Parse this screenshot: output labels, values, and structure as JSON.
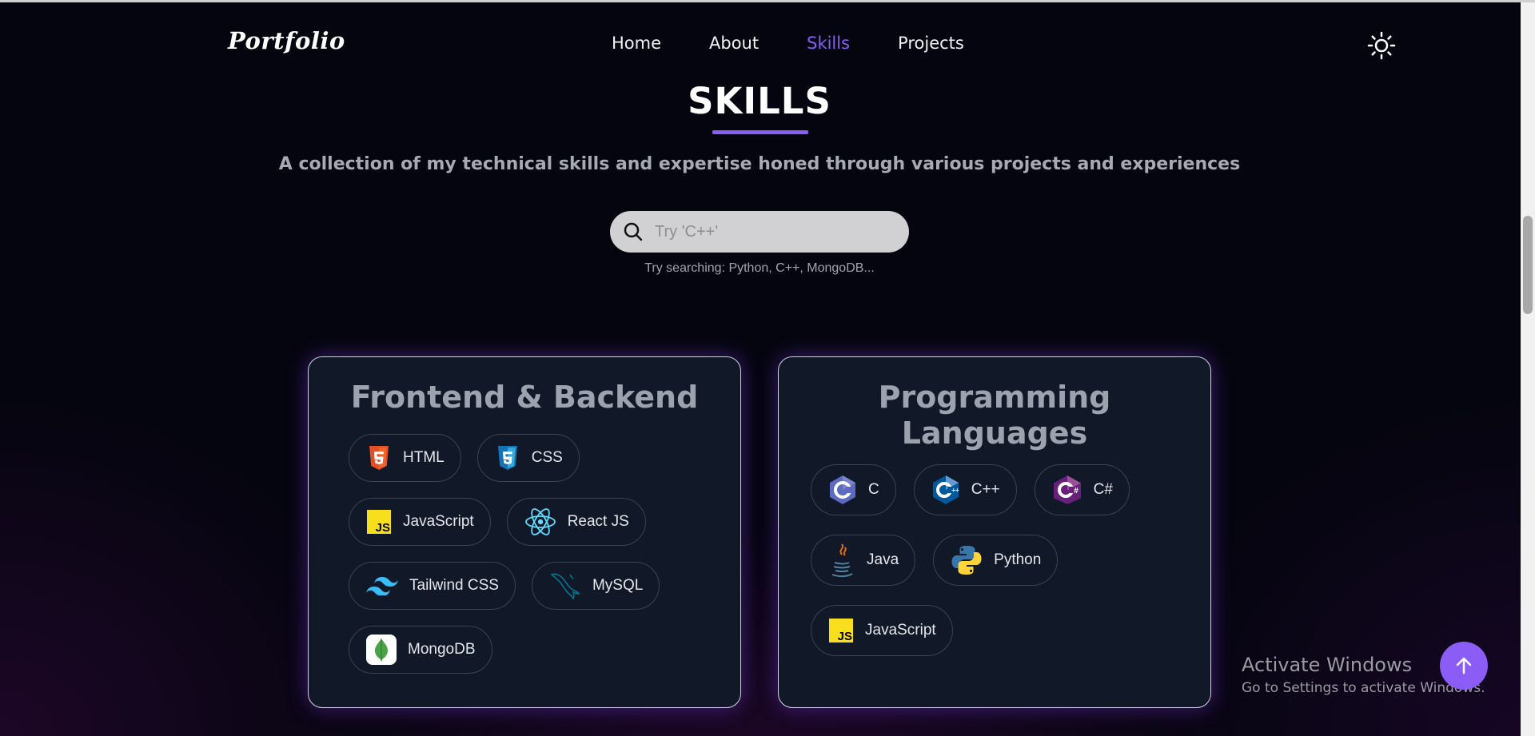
{
  "nav": {
    "logo": "Portfolio",
    "items": [
      {
        "label": "Home",
        "active": false
      },
      {
        "label": "About",
        "active": false
      },
      {
        "label": "Skills",
        "active": true
      },
      {
        "label": "Projects",
        "active": false
      }
    ],
    "theme_icon": "sun-icon"
  },
  "header": {
    "title": "SKILLS",
    "subtitle": "A collection of my technical skills and expertise honed through various projects and experiences"
  },
  "search": {
    "placeholder": "Try 'C++'",
    "value": "",
    "hint": "Try searching: Python, C++, MongoDB..."
  },
  "cards": [
    {
      "title": "Frontend & Backend",
      "skills": [
        {
          "label": "HTML",
          "icon": "html5-icon"
        },
        {
          "label": "CSS",
          "icon": "css3-icon"
        },
        {
          "label": "JavaScript",
          "icon": "javascript-icon"
        },
        {
          "label": "React JS",
          "icon": "react-icon"
        },
        {
          "label": "Tailwind CSS",
          "icon": "tailwind-icon"
        },
        {
          "label": "MySQL",
          "icon": "mysql-icon"
        },
        {
          "label": "MongoDB",
          "icon": "mongodb-icon"
        }
      ]
    },
    {
      "title_line1": "Programming",
      "title_line2": "Languages",
      "skills": [
        {
          "label": "C",
          "icon": "c-icon"
        },
        {
          "label": "C++",
          "icon": "cpp-icon"
        },
        {
          "label": "C#",
          "icon": "csharp-icon"
        },
        {
          "label": "Java",
          "icon": "java-icon"
        },
        {
          "label": "Python",
          "icon": "python-icon"
        },
        {
          "label": "JavaScript",
          "icon": "javascript-icon"
        }
      ]
    }
  ],
  "overlay": {
    "line1": "Activate Windows",
    "line2": "Go to Settings to activate Windows."
  },
  "colors": {
    "accent": "#8b5cf6",
    "background": "#05050f",
    "card": "#111827"
  }
}
